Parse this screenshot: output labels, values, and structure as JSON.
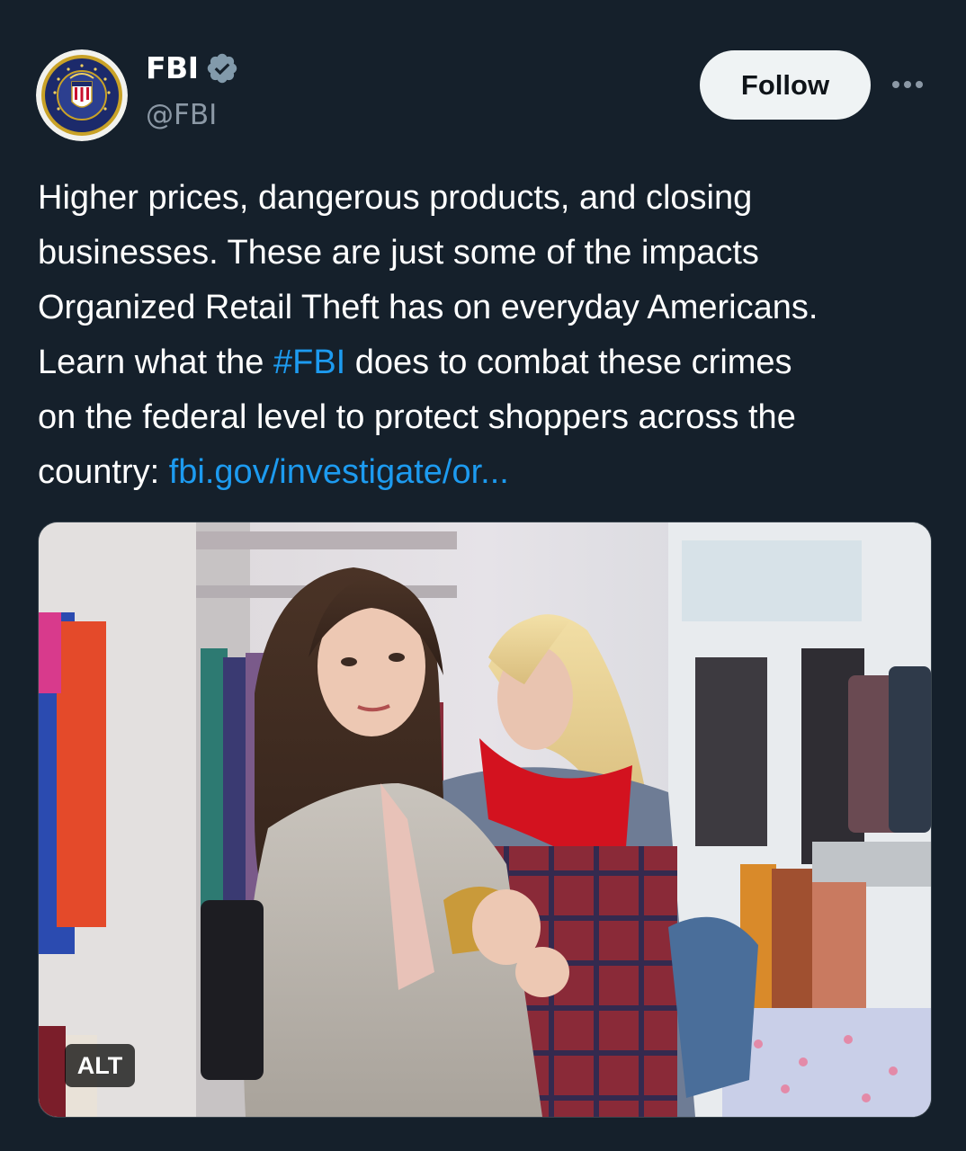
{
  "author": {
    "name": "FBI",
    "handle": "@FBI",
    "verified": true,
    "avatar_icon": "fbi-seal"
  },
  "actions": {
    "follow_label": "Follow",
    "more_icon": "more-dots-icon"
  },
  "tweet": {
    "lines": [
      [
        {
          "text": "Higher prices, dangerous products, and closing"
        }
      ],
      [
        {
          "text": "businesses. These are just some of the impacts"
        }
      ],
      [
        {
          "text": "Organized Retail Theft has on everyday Americans."
        }
      ],
      [
        {
          "text": "Learn what the "
        },
        {
          "text": "#FBI",
          "link": true
        },
        {
          "text": " does to combat these crimes"
        }
      ],
      [
        {
          "text": "on the federal level to protect shoppers across the"
        }
      ],
      [
        {
          "text": "country: "
        },
        {
          "text": "fbi.gov/investigate/or...",
          "link": true
        }
      ]
    ]
  },
  "media": {
    "alt_label": "ALT"
  },
  "colors": {
    "background": "#15202b",
    "link": "#1d9bf0",
    "secondary_text": "#8b98a5",
    "follow_button_bg": "#eff3f4"
  }
}
